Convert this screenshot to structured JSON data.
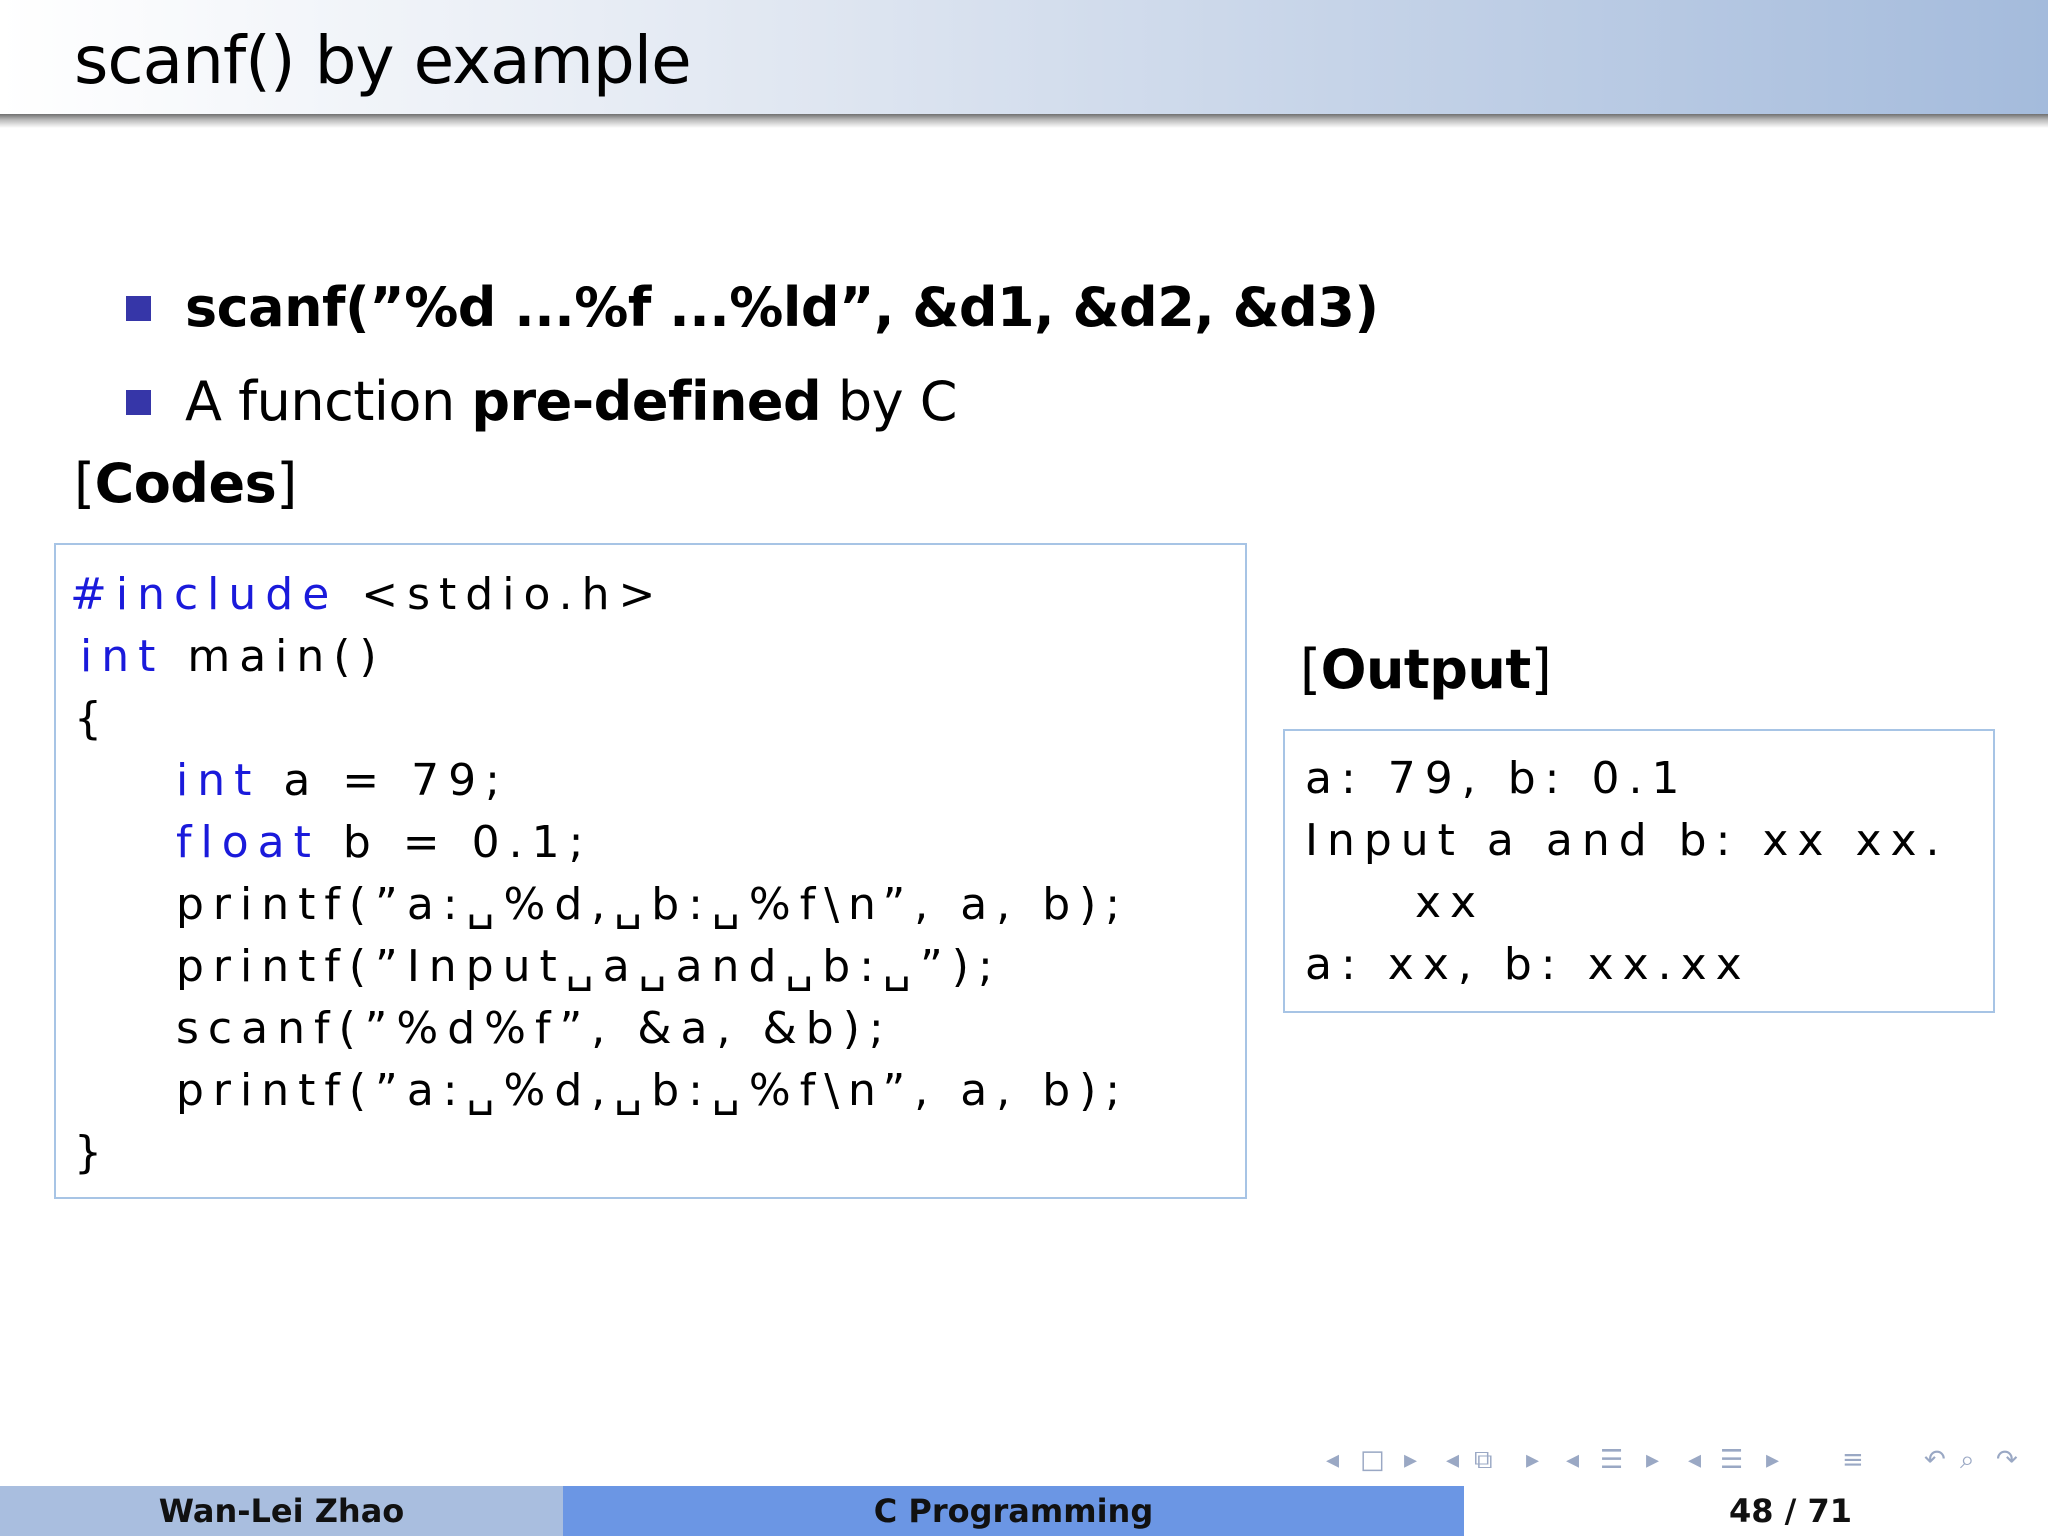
{
  "slide": {
    "title": "scanf() by example"
  },
  "bullets": [
    {
      "text": "scanf(”%d ...%f ...%ld”, &d1, &d2, &d3)"
    },
    {
      "prefix": "A function ",
      "bold": "pre-defined",
      "suffix": " by C"
    }
  ],
  "codes_label": "[Codes]",
  "output_label": "[Output]",
  "code": {
    "line1_kw": "#include",
    "line1_rest": " <stdio.h>",
    "line2_kw": "int",
    "line2_rest": " main()",
    "line3": "{",
    "line4_kw": "int",
    "line4_rest": " a = 79;",
    "line5_kw": "float",
    "line5_rest": " b = 0.1;",
    "line6": "printf(”a:␣%d,␣b:␣%f\\n”, a, b);",
    "line7": "printf(”Input␣a␣and␣b:␣”);",
    "line8": "scanf(”%d%f”, &a, &b);",
    "line9": "printf(”a:␣%d,␣b:␣%f\\n”, a, b);",
    "line10": "}"
  },
  "output": {
    "line1": "a: 79, b: 0.1",
    "line2": "Input a and b: xx xx.",
    "line3": "xx",
    "line4": "a: xx, b: xx.xx"
  },
  "nav": {
    "icons": [
      "arrow-left-icon",
      "frame-icon",
      "arrow-right-icon",
      "arrow-left-icon",
      "subsection-icon",
      "arrow-right-icon",
      "arrow-left-icon",
      "section-icon",
      "arrow-right-icon",
      "arrow-left-icon",
      "subsubsection-icon",
      "arrow-right-icon",
      "align-icon",
      "undo-icon",
      "search-icon"
    ]
  },
  "footer": {
    "author": "Wan-Lei Zhao",
    "course": "C Programming",
    "page_current": "48",
    "page_separator": "/",
    "page_total": "71"
  },
  "colors": {
    "bullet": "#3636a8",
    "keyword": "#1a1adb",
    "box_border": "#a7c4e5",
    "footer_left": "#a9bedf",
    "footer_mid": "#6b96e4"
  }
}
